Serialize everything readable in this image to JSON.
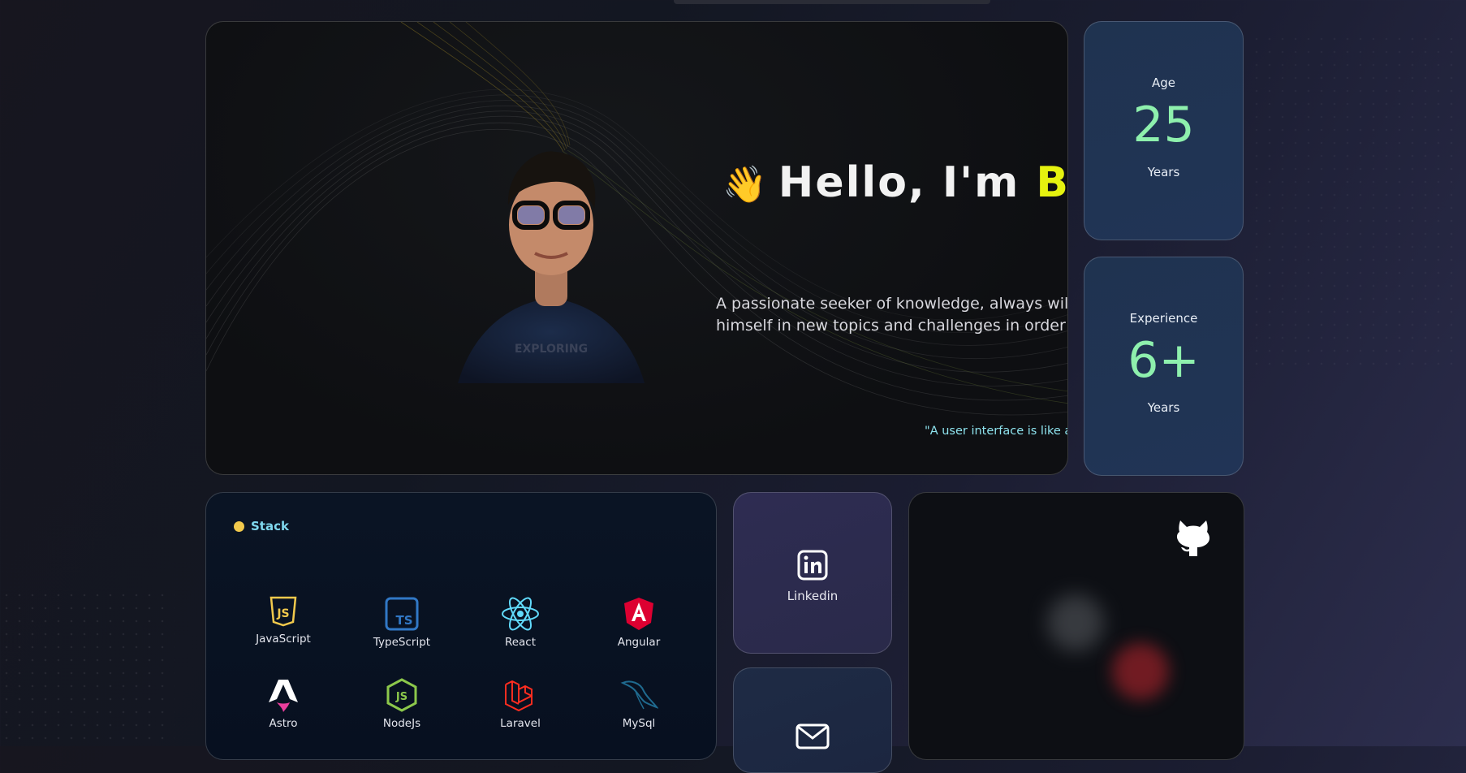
{
  "hero": {
    "wave_emoji": "👋",
    "greeting": "Hello, I'm",
    "name": "Brandol_",
    "bio": "A passionate seeker of knowledge, always willing to immerse himself in new topics and challenges in order to constantly grow.",
    "quote": "\"A user interface is like a joke. If you have to explain it, it's not so good\"",
    "shirt_text": "EXPLORING"
  },
  "stats": {
    "age": {
      "label": "Age",
      "value": "25",
      "unit": "Years"
    },
    "experience": {
      "label": "Experience",
      "value": "6+",
      "unit": "Years"
    }
  },
  "stack": {
    "title": "Stack",
    "items": [
      {
        "label": "JavaScript",
        "icon": "javascript-icon",
        "color": "#f2c94c"
      },
      {
        "label": "TypeScript",
        "icon": "typescript-icon",
        "color": "#3178c6"
      },
      {
        "label": "React",
        "icon": "react-icon",
        "color": "#61dafb"
      },
      {
        "label": "Angular",
        "icon": "angular-icon",
        "color": "#dd0031"
      },
      {
        "label": "Astro",
        "icon": "astro-icon",
        "color": "#ffffff"
      },
      {
        "label": "NodeJs",
        "icon": "nodejs-icon",
        "color": "#8cc84b"
      },
      {
        "label": "Laravel",
        "icon": "laravel-icon",
        "color": "#ff2d20"
      },
      {
        "label": "MySql",
        "icon": "mysql-icon",
        "color": "#00618a"
      }
    ]
  },
  "social": {
    "linkedin": {
      "label": "Linkedin",
      "icon": "linkedin-icon"
    },
    "mail": {
      "icon": "mail-icon"
    },
    "github": {
      "icon": "github-icon"
    }
  },
  "colors": {
    "accent_name": "#e5f20f",
    "stat_number": "#8ef0ad",
    "quote": "#8ee3ee",
    "stack_title": "#7fd8ee"
  }
}
